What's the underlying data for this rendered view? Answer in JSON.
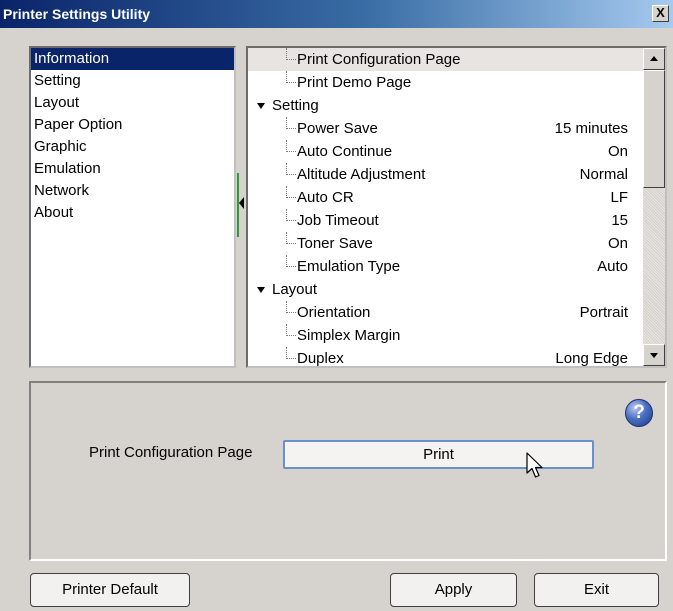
{
  "window": {
    "title": "Printer Settings Utility",
    "close_label": "X"
  },
  "nav": {
    "items": [
      {
        "label": "Information",
        "selected": true
      },
      {
        "label": "Setting"
      },
      {
        "label": "Layout"
      },
      {
        "label": "Paper Option"
      },
      {
        "label": "Graphic"
      },
      {
        "label": "Emulation"
      },
      {
        "label": "Network"
      },
      {
        "label": "About"
      }
    ]
  },
  "tree": {
    "info_leaves": [
      {
        "label": "Print Configuration Page",
        "highlighted": true
      },
      {
        "label": "Print Demo Page"
      }
    ],
    "setting": {
      "label": "Setting",
      "rows": [
        {
          "label": "Power Save",
          "value": "15 minutes"
        },
        {
          "label": "Auto Continue",
          "value": "On"
        },
        {
          "label": "Altitude Adjustment",
          "value": "Normal"
        },
        {
          "label": "Auto CR",
          "value": "LF"
        },
        {
          "label": "Job Timeout",
          "value": "15"
        },
        {
          "label": "Toner Save",
          "value": "On"
        },
        {
          "label": "Emulation Type",
          "value": "Auto"
        }
      ]
    },
    "layout": {
      "label": "Layout",
      "rows": [
        {
          "label": "Orientation",
          "value": "Portrait"
        },
        {
          "label": "Simplex Margin",
          "value": ""
        },
        {
          "label": "Duplex",
          "value": "Long Edge"
        }
      ]
    }
  },
  "detail": {
    "field_label": "Print Configuration Page",
    "print_label": "Print",
    "help_glyph": "?",
    "help_icon": "help-icon"
  },
  "footer": {
    "default_label": "Printer Default",
    "apply_label": "Apply",
    "exit_label": "Exit"
  },
  "colors": {
    "title_start": "#0a246a",
    "title_end": "#a6caf0",
    "selection": "#0a246a",
    "print_border": "#6a8fce",
    "splitter": "#2d9b3a"
  }
}
